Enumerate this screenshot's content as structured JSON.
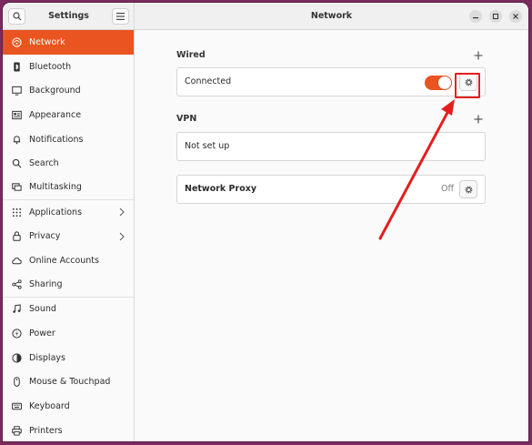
{
  "sidebar": {
    "title": "Settings",
    "items": [
      {
        "label": "Network",
        "icon": "network-icon",
        "active": true
      },
      {
        "label": "Bluetooth",
        "icon": "bluetooth-icon"
      },
      {
        "label": "Background",
        "icon": "background-icon"
      },
      {
        "label": "Appearance",
        "icon": "appearance-icon"
      },
      {
        "label": "Notifications",
        "icon": "bell-icon"
      },
      {
        "label": "Search",
        "icon": "search-icon"
      },
      {
        "label": "Multitasking",
        "icon": "multitasking-icon"
      },
      {
        "label": "Applications",
        "icon": "grid-icon",
        "chevron": true
      },
      {
        "label": "Privacy",
        "icon": "lock-icon",
        "chevron": true
      },
      {
        "label": "Online Accounts",
        "icon": "cloud-icon"
      },
      {
        "label": "Sharing",
        "icon": "share-icon"
      },
      {
        "label": "Sound",
        "icon": "music-note-icon"
      },
      {
        "label": "Power",
        "icon": "power-icon"
      },
      {
        "label": "Displays",
        "icon": "display-icon"
      },
      {
        "label": "Mouse & Touchpad",
        "icon": "mouse-icon"
      },
      {
        "label": "Keyboard",
        "icon": "keyboard-icon"
      },
      {
        "label": "Printers",
        "icon": "printer-icon"
      }
    ]
  },
  "header": {
    "title": "Network"
  },
  "wired": {
    "label": "Wired",
    "status": "Connected",
    "toggle_on": true
  },
  "vpn": {
    "label": "VPN",
    "status": "Not set up"
  },
  "proxy": {
    "label": "Network Proxy",
    "status": "Off"
  },
  "colors": {
    "accent": "#e95420",
    "annotation": "#e41e1e",
    "desktop": "#7b2b5e"
  }
}
